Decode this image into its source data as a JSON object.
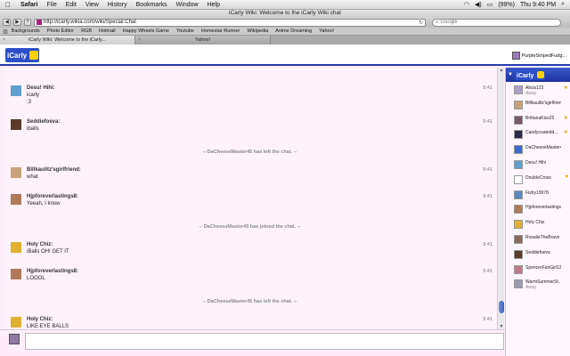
{
  "menubar": {
    "app": "Safari",
    "items": [
      "File",
      "Edit",
      "View",
      "History",
      "Bookmarks",
      "Window",
      "Help"
    ],
    "battery": "(99%)",
    "clock": "Thu 9:40 PM"
  },
  "window": {
    "title": "iCarly Wiki: Welcome to the iCarly Wiki chat"
  },
  "toolbar": {
    "back": "◀",
    "forward": "▶",
    "add": "+",
    "url": "http://icarly.wikia.com/wiki/Special:Chat",
    "search_placeholder": "Google"
  },
  "bookmarks": [
    "Backgrounds",
    "Photo Editor",
    "RGB",
    "Hotmail",
    "Happy Wheels Game",
    "Youtube",
    "Homestar Runner",
    "Wikipedia",
    "Anime Dreaming",
    "Yahoo!"
  ],
  "tabs": [
    {
      "label": "iCarly Wiki: Welcome to the iCarly..."
    },
    {
      "label": "Yahoo!"
    }
  ],
  "header": {
    "username": "PurpleStripedFudg..."
  },
  "messages": [
    {
      "name": "Desu! Hihi:",
      "time": "9:41",
      "lines": [
        "icarly",
        ":3"
      ],
      "avatar_color": "#5fa0cf"
    },
    {
      "name": "Seddiefoeva:",
      "time": "9:41",
      "lines": [
        "iballs"
      ],
      "avatar_color": "#5a3a2a"
    },
    {
      "alert": "-- DaCheeseMaster45 has left the chat. --"
    },
    {
      "name": "Billkaulitz'sgirlfriend:",
      "time": "9:41",
      "lines": [
        "what"
      ],
      "avatar_color": "#c9a27a"
    },
    {
      "name": "Hjpforeverlastings8:",
      "time": "9:41",
      "lines": [
        "Yeeah, I know"
      ],
      "avatar_color": "#b07a5a"
    },
    {
      "alert": "-- DaCheeseMaster45 has joined the chat. --"
    },
    {
      "name": "Holy Chiz:",
      "time": "9:41",
      "lines": [
        "iBalls OH! GET IT"
      ],
      "avatar_color": "#e0b030"
    },
    {
      "name": "Hjpforeverlastings8:",
      "time": "9:41",
      "lines": [
        "LOOOL"
      ],
      "avatar_color": "#b07a5a"
    },
    {
      "alert": "-- DaCheeseMaster45 has left the chat. --"
    },
    {
      "name": "Holy Chiz:",
      "time": "9:41",
      "lines": [
        "LIKE EYE BALLS",
        ":D"
      ],
      "avatar_color": "#e0b030"
    }
  ],
  "users": [
    {
      "name": "Alicia123",
      "status": "Away",
      "star": "★",
      "color": "#aaa0c8"
    },
    {
      "name": "Billkaulitz'sgirlfriend",
      "status": "",
      "star": "",
      "color": "#c9a27a"
    },
    {
      "name": "BrittanaKiss25",
      "status": "",
      "star": "★",
      "color": "#7a5a6a"
    },
    {
      "name": "Candycoatedd...",
      "status": "",
      "star": "★",
      "color": "#2a2a4a"
    },
    {
      "name": "DaCheeseMaster45",
      "status": "",
      "star": "",
      "color": "#3a6ad0"
    },
    {
      "name": "Desu! Hihi",
      "status": "",
      "star": "",
      "color": "#5fa0cf"
    },
    {
      "name": "DoubleCross",
      "status": "",
      "star": "♥",
      "color": "#ffffff"
    },
    {
      "name": "Fishy19978",
      "status": "",
      "star": "",
      "color": "#5a8ac0"
    },
    {
      "name": "Hjpforeverlastings8",
      "status": "",
      "star": "",
      "color": "#b07a5a"
    },
    {
      "name": "Holy Chiz",
      "status": "",
      "star": "",
      "color": "#e0b030"
    },
    {
      "name": "RosalieTheBrave",
      "status": "",
      "star": "",
      "color": "#8a6a5a"
    },
    {
      "name": "Seddiefoeva",
      "status": "",
      "star": "",
      "color": "#5a3a2a"
    },
    {
      "name": "SpencerFanGirl123",
      "status": "",
      "star": "",
      "color": "#c07a8a"
    },
    {
      "name": "WarmSummerSt...",
      "status": "Away",
      "star": "",
      "color": "#9a9ab0"
    }
  ]
}
